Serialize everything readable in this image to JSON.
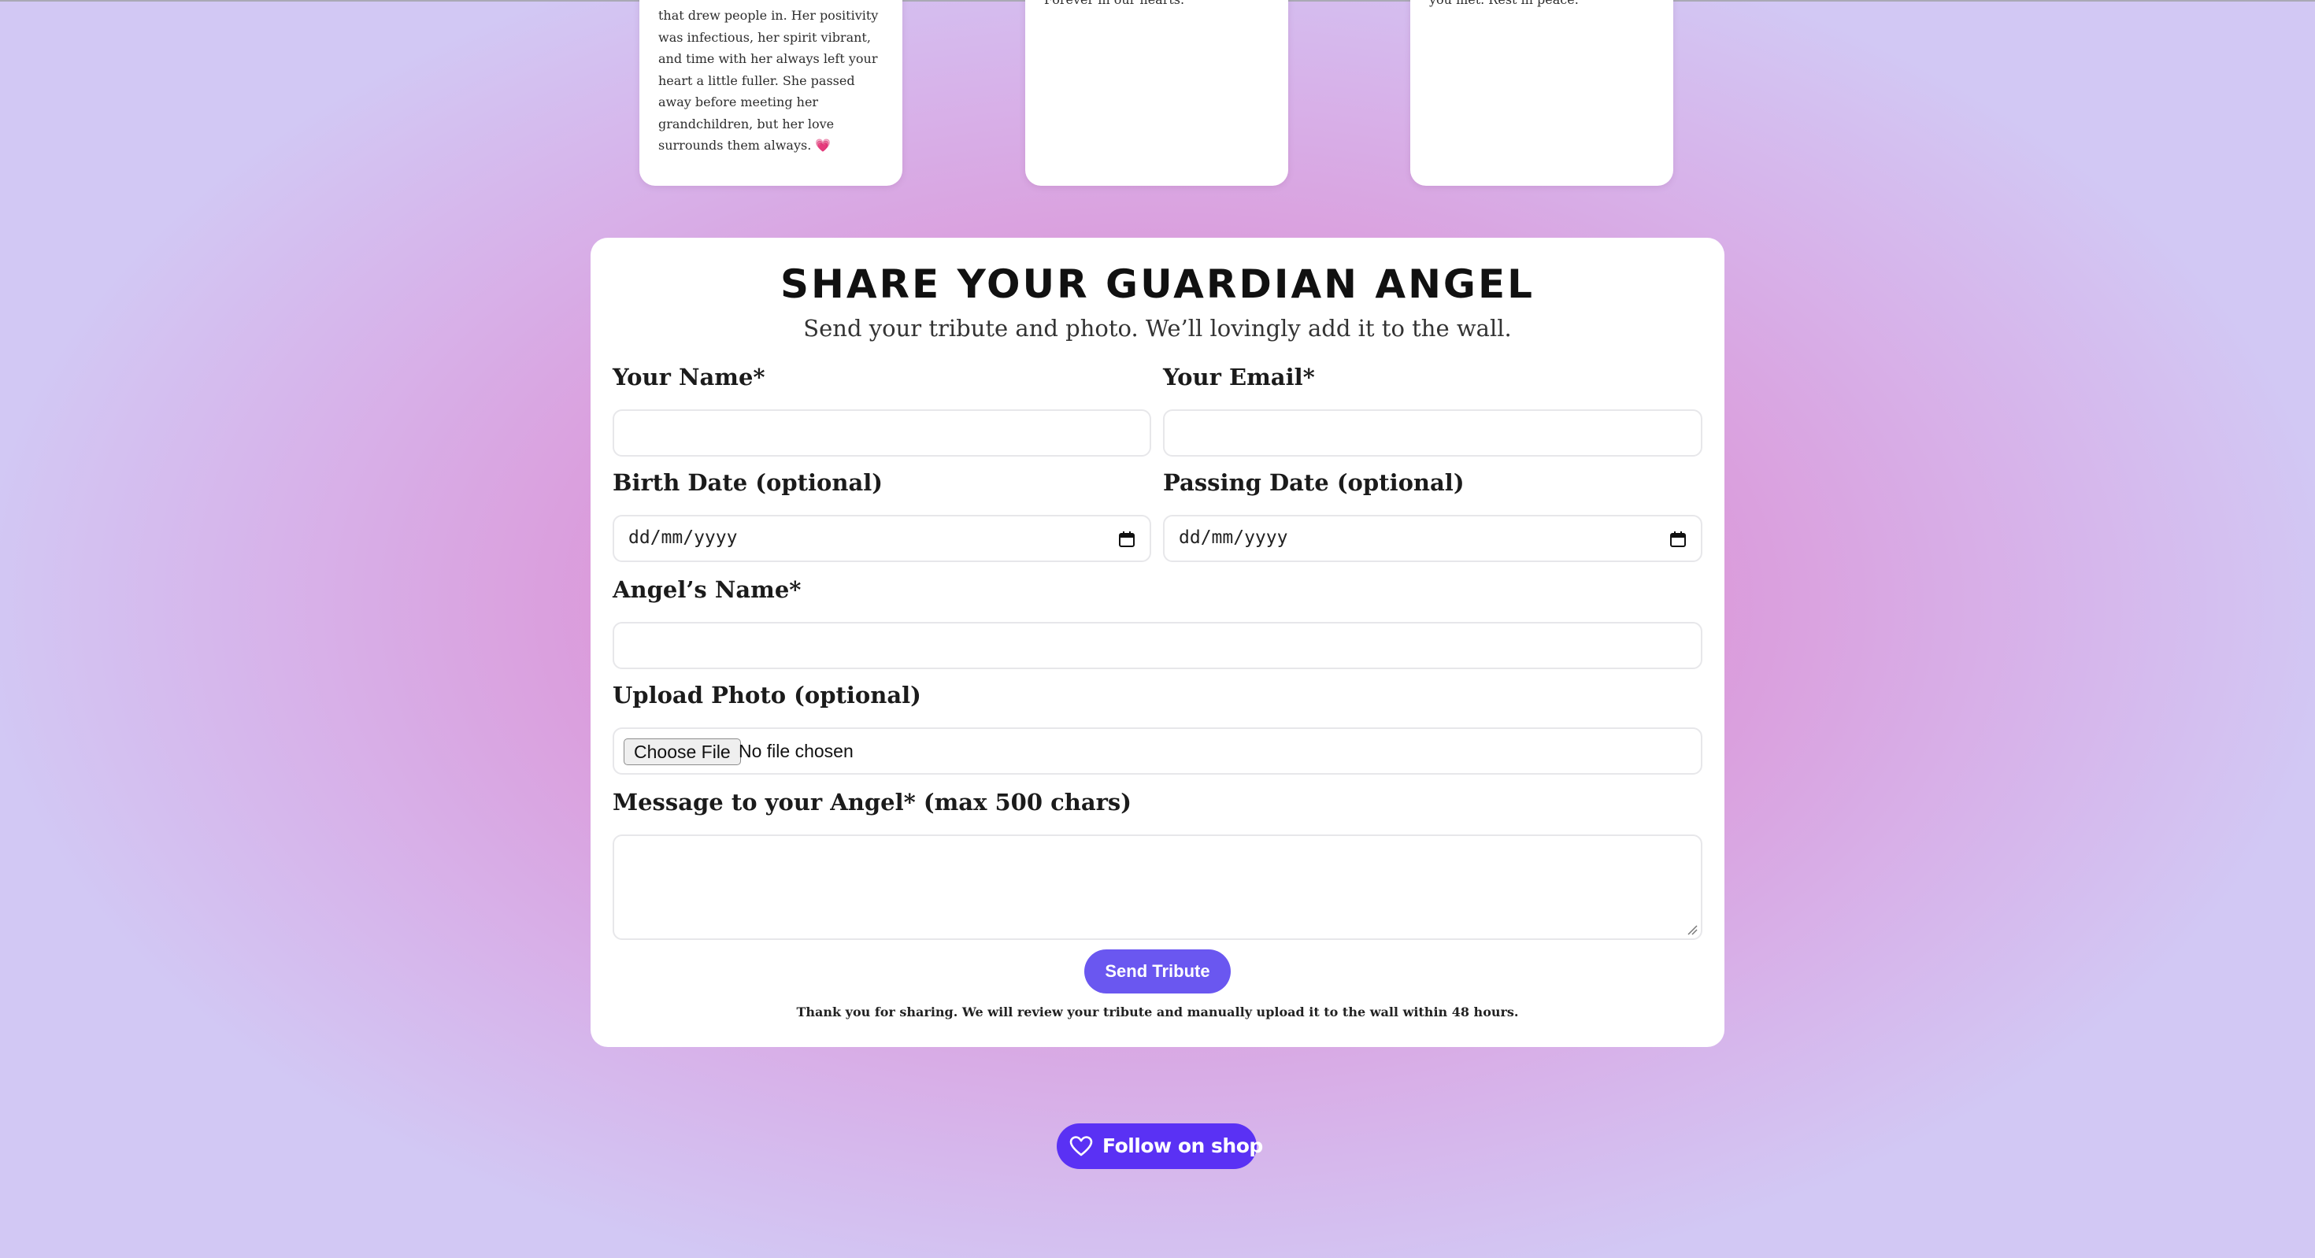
{
  "tribute_cards": [
    {
      "lines": [
        "that drew people in. Her positivity",
        "was infectious, her spirit vibrant,",
        "and time with her always left your",
        "heart a little fuller. She passed",
        "away before meeting her",
        "grandchildren, but her love",
        "surrounds them always. 💗"
      ]
    },
    {
      "lines": [
        "Forever in our hearts."
      ]
    },
    {
      "lines": [
        "you met. Rest in peace."
      ]
    }
  ],
  "form": {
    "title": "Share Your Guardian Angel",
    "subtitle": "Send your tribute and photo. We’ll lovingly add it to the wall.",
    "fields": {
      "your_name": {
        "label": "Your Name*",
        "value": ""
      },
      "your_email": {
        "label": "Your Email*",
        "value": ""
      },
      "birth_date": {
        "label": "Birth Date (optional)",
        "placeholder": "dd/mm/yyyy"
      },
      "passing_date": {
        "label": "Passing Date (optional)",
        "placeholder": "dd/mm/yyyy"
      },
      "angel_name": {
        "label": "Angel’s Name*",
        "value": ""
      },
      "upload_photo": {
        "label": "Upload Photo (optional)",
        "button_label": "Choose File",
        "status": "No file chosen"
      },
      "message": {
        "label": "Message to your Angel* (max 500 chars)",
        "value": ""
      }
    },
    "submit_label": "Send Tribute",
    "thanks_note": "Thank you for sharing. We will review your tribute and manually upload it to the wall within 48 hours."
  },
  "follow": {
    "label": "Follow on shop",
    "icon": "heart-icon"
  },
  "colors": {
    "accent": "#6a57f0",
    "shop_purple": "#5a31f4",
    "card_bg": "#ffffff"
  }
}
